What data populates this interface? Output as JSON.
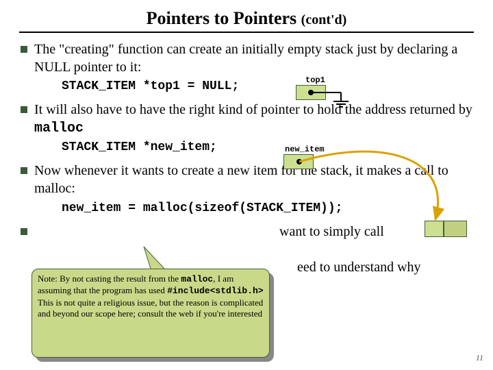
{
  "title_main": "Pointers to Pointers ",
  "title_sub": "(cont'd)",
  "bullets": [
    {
      "text_a": "The \"creating\" function can create an initially empty stack just by declaring a NULL pointer to it:",
      "code": "STACK_ITEM *top1 = NULL;",
      "label": "top1"
    },
    {
      "text_a": "It will also have to have the right kind of pointer to hold the address returned by ",
      "mono": "malloc",
      "code": "STACK_ITEM *new_item;",
      "label": "new_item"
    },
    {
      "text_a": "Now whenever it wants to create a new item for the stack,  it makes a call to malloc:",
      "code": "new_item = malloc(sizeof(STACK_ITEM));"
    },
    {
      "frag_right": " want to simply call",
      "frag_mid": "eed to understand why"
    }
  ],
  "note": {
    "l1a": "Note:  By not casting the result from the ",
    "l2a": "malloc",
    "l2b": ", I am assuming that the program has used ",
    "l3a": "#include<stdlib.h>",
    "l3b": "   This is not quite a religious issue, but the reason is complicated and beyond our scope here; consult the web if you're interested"
  },
  "pagenum": "11"
}
